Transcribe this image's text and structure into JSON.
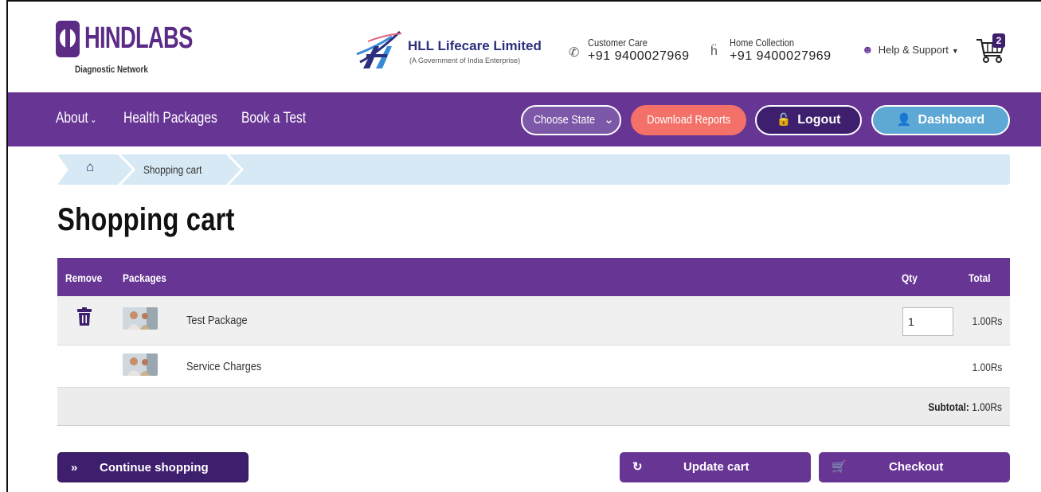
{
  "brand": {
    "name": "HINDLABS",
    "tagline": "Diagnostic Network",
    "partner_name": "HLL Lifecare Limited",
    "partner_sub": "(A Government of India Enterprise)"
  },
  "contacts": {
    "customer_care_label": "Customer Care",
    "customer_care_number": "+91 9400027969",
    "home_collection_label": "Home Collection",
    "home_collection_number": "+91 9400027969"
  },
  "help": {
    "label": "Help & Support"
  },
  "cart": {
    "count": "2"
  },
  "nav": {
    "about": "About",
    "health_packages": "Health Packages",
    "book_test": "Book a Test",
    "choose_state": "Choose State",
    "download_reports": "Download Reports",
    "logout": "Logout",
    "dashboard": "Dashboard"
  },
  "breadcrumb": {
    "current": "Shopping cart"
  },
  "page": {
    "title": "Shopping cart"
  },
  "table": {
    "headers": {
      "remove": "Remove",
      "packages": "Packages",
      "qty": "Qty",
      "total": "Total"
    },
    "rows": [
      {
        "name": "Test Package",
        "qty": "1",
        "total": "1.00Rs",
        "removable": true
      },
      {
        "name": "Service Charges",
        "qty": "",
        "total": "1.00Rs",
        "removable": false
      }
    ],
    "subtotal_label": "Subtotal:",
    "subtotal_value": "1.00Rs"
  },
  "actions": {
    "continue": "Continue shopping",
    "update": "Update cart",
    "checkout": "Checkout"
  },
  "colors": {
    "primary": "#673594",
    "dark": "#3e1f6e",
    "coral": "#f37168",
    "sky": "#5da8d4",
    "crumb_bg": "#d6e9f4"
  }
}
